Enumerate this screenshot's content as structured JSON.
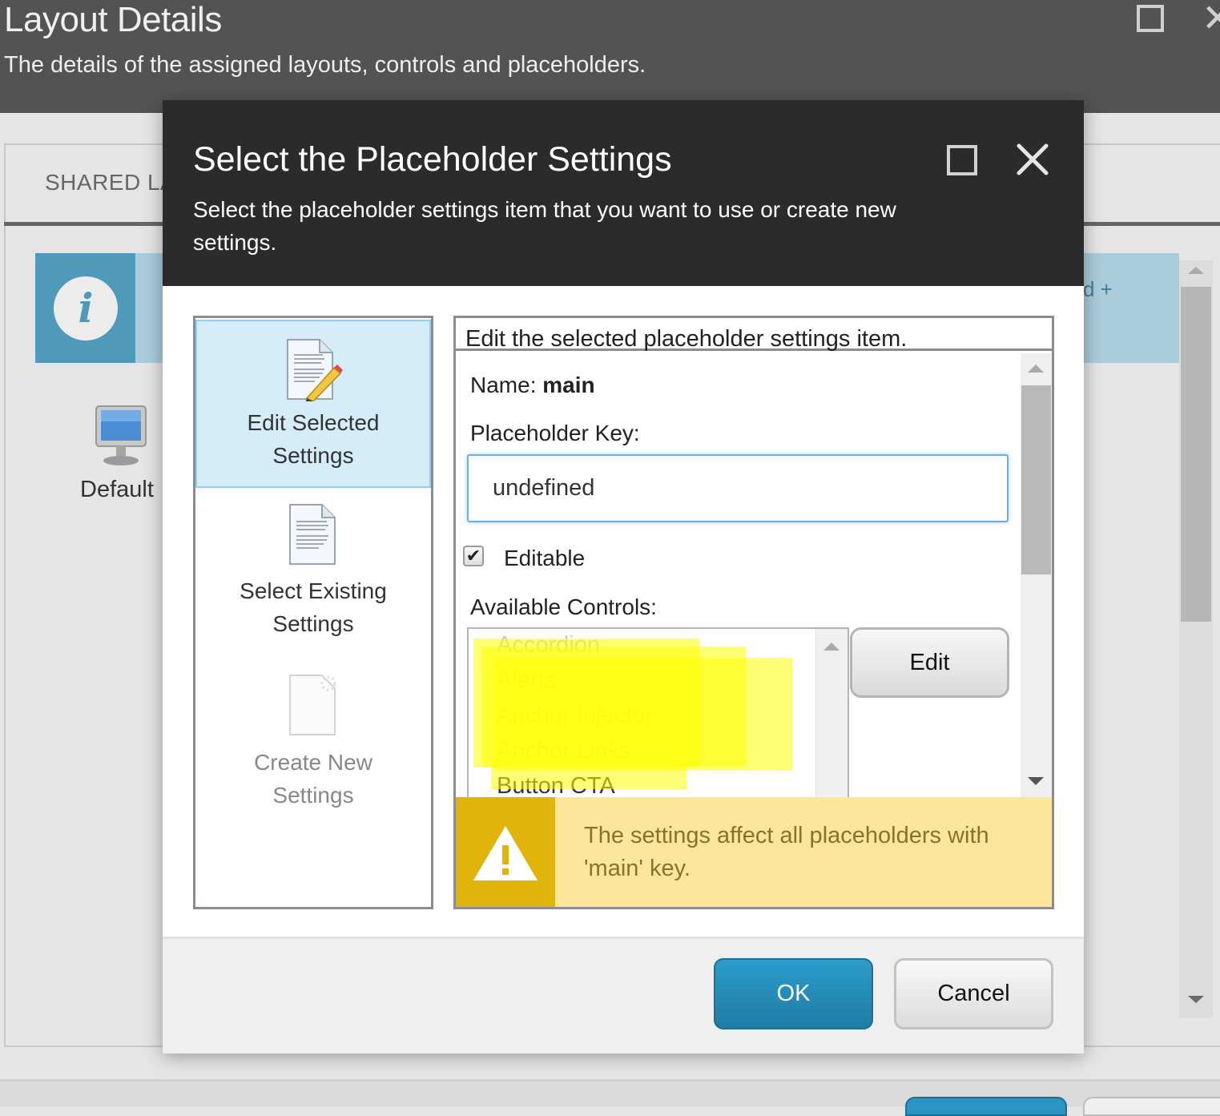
{
  "background_window": {
    "title": "Layout Details",
    "subtitle": "The details of the assigned layouts, controls and placeholders.",
    "tab_label": "SHARED LA",
    "info_partial_text": "d +",
    "device_label": "Default",
    "icons": {
      "maximize": "maximize-icon",
      "close": "close-icon",
      "info": "info-icon",
      "device": "monitor-icon"
    }
  },
  "dialog": {
    "title": "Select the Placeholder Settings",
    "subtitle": "Select the placeholder settings item that you want to use or create new settings.",
    "options": [
      {
        "label": "Edit Selected Settings",
        "icon": "document-edit-icon",
        "selected": true,
        "enabled": true
      },
      {
        "label": "Select Existing Settings",
        "icon": "document-icon",
        "selected": false,
        "enabled": true
      },
      {
        "label": "Create New Settings",
        "icon": "new-document-icon",
        "selected": false,
        "enabled": false
      }
    ],
    "panel": {
      "heading": "Edit the selected placeholder settings item.",
      "name_label": "Name:",
      "name_value": "main",
      "key_label": "Placeholder Key:",
      "key_value": "undefined",
      "editable_label": "Editable",
      "editable_checked": true,
      "controls_label": "Available Controls:",
      "controls": [
        "Accordion",
        "Alerts",
        "Anchor Injector",
        "Anchor Links",
        "Button CTA"
      ],
      "edit_button": "Edit",
      "warning": "The settings affect all placeholders with 'main' key."
    },
    "ok_button": "OK",
    "cancel_button": "Cancel"
  },
  "colors": {
    "dialog_header": "#2b2b2b",
    "primary_button": "#2490bf",
    "selected_option": "#d5ecf9",
    "warning_bg": "#fbe699",
    "warning_accent": "#e0b40a",
    "info_bg": "#abccdb",
    "info_accent": "#4f9aba",
    "redaction_highlight": "#ffff00"
  }
}
